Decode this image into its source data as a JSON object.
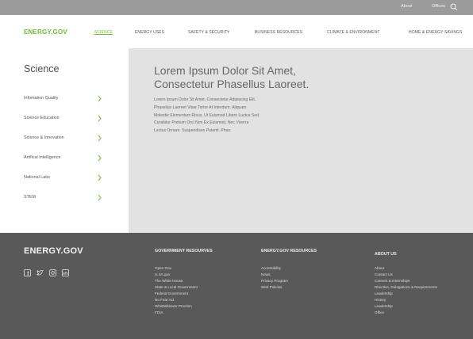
{
  "topbar": {
    "about": "About",
    "offices": "Offices",
    "search_icon": "search-icon"
  },
  "nav": {
    "logo": "ENERGY.GOV",
    "items": [
      {
        "label": "SCIENCE",
        "active": true
      },
      {
        "label": "ENERGY USES",
        "active": false
      },
      {
        "label": "SAFETY & SECURITY",
        "active": false
      },
      {
        "label": "BUSINESS RESOURCES",
        "active": false
      },
      {
        "label": "CLIMATE & ENVIRONMENT",
        "active": false
      },
      {
        "label": "HOME & ENERGY SAVINGS",
        "active": false
      }
    ]
  },
  "sidebar": {
    "title": "Science",
    "items": [
      {
        "label": "Infomation Quality",
        "icon": "chevron-right-icon"
      },
      {
        "label": "Sceince Education",
        "icon": "chevron-right-icon"
      },
      {
        "label": "Science & Innovation",
        "icon": "chevron-right-icon"
      },
      {
        "label": "Artifical Intelligence",
        "icon": "chevron-right-icon"
      },
      {
        "label": "National Labs",
        "icon": "chevron-right-icon"
      },
      {
        "label": "STEM",
        "icon": "chevron-right-icon"
      }
    ]
  },
  "main": {
    "headline_line1": "Lorem Ipsum Dolor Sit Amet,",
    "headline_line2": "Consectetur  Phasellus Laoreet.",
    "body_lines": [
      "Lorem Ipsum Dolor Sit Amet, Consectetur Adipiscing Elit.",
      "Phasellus Laoreet Vitae Tortor At Interdum. Aliquam",
      "Molestie Elementum Risus, Ut Euismod Libero Luctus Sed.",
      "Curabitur Pretium Orci Non Ex Euismod, Nec Viverra",
      "Lectus Ornare. Suspendisse Potenti. Phas."
    ]
  },
  "footer": {
    "logo": "ENERGY.GOV",
    "social_icons": [
      "facebook-icon",
      "twitter-icon",
      "instagram-icon",
      "linkedin-icon"
    ],
    "columns": [
      {
        "title": "GOVERNMENT RESOURVES",
        "links": [
          "Open Gov",
          "U.SA.gov",
          "The White House",
          "State & Local Government",
          "Federal Government",
          "No Fear Act",
          "Whistleblower Proction",
          "FOIA"
        ]
      },
      {
        "title": "ENERGY.GOV RESOURCES",
        "links": [
          "Accessibility",
          "News",
          "Privacy Program",
          "Web Policies"
        ]
      },
      {
        "title": "ABOUT US",
        "links": [
          "About",
          "Contact Us",
          "Careers & Internships",
          "Directive, Delegations & Requirements",
          "Leadership",
          "History",
          "Leadership",
          "Office"
        ]
      }
    ]
  },
  "colors": {
    "brand_green": "#6fbf2f",
    "topbar": "#9b9b9b",
    "content_panel": "#e2e2e2",
    "footer": "#595959"
  }
}
